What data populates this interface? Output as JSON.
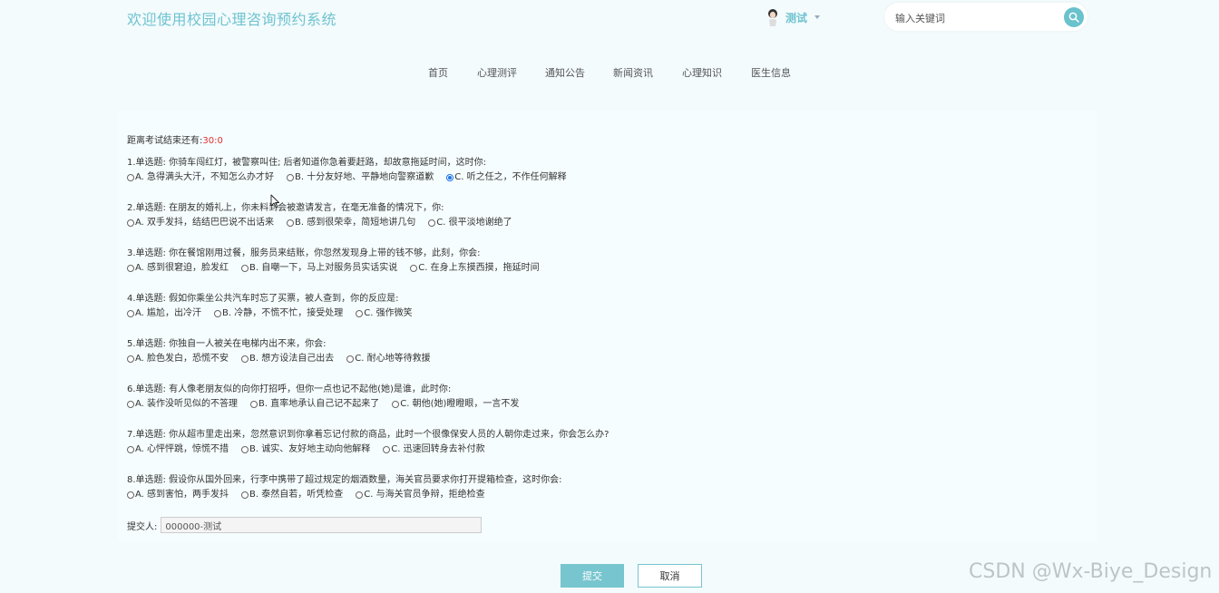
{
  "header": {
    "site_title": "欢迎使用校园心理咨询预约系统",
    "username": "测试",
    "search_placeholder": "输入关键词"
  },
  "nav": {
    "items": [
      "首页",
      "心理测评",
      "通知公告",
      "新闻资讯",
      "心理知识",
      "医生信息"
    ]
  },
  "exam": {
    "timer_label": "距离考试结束还有:",
    "timer_value": "30:0",
    "questions": [
      {
        "title": "1.单选题: 你骑车闯红灯，被警察叫住; 后者知道你急着要赶路，却故意拖延时间，这时你:",
        "options": [
          "A. 急得满头大汗，不知怎么办才好",
          "B. 十分友好地、平静地向警察道歉",
          "C. 听之任之，不作任何解释"
        ],
        "selected": 2
      },
      {
        "title": "2.单选题: 在朋友的婚礼上，你未料到会被邀请发言，在毫无准备的情况下，你:",
        "options": [
          "A. 双手发抖，结结巴巴说不出话来",
          "B. 感到很荣幸，简短地讲几句",
          "C. 很平淡地谢绝了"
        ],
        "selected": -1
      },
      {
        "title": "3.单选题: 你在餐馆刚用过餐，服务员来结账，你忽然发现身上带的钱不够，此刻，你会:",
        "options": [
          "A. 感到很窘迫，脸发红",
          "B. 自嘲一下，马上对服务员实话实说",
          "C. 在身上东摸西摸，拖延时间"
        ],
        "selected": -1
      },
      {
        "title": "4.单选题: 假如你乘坐公共汽车时忘了买票，被人查到，你的反应是:",
        "options": [
          "A. 尴尬，出冷汗",
          "B. 冷静，不慌不忙，接受处理",
          "C. 强作微笑"
        ],
        "selected": -1
      },
      {
        "title": "5.单选题: 你独自一人被关在电梯内出不来，你会:",
        "options": [
          "A. 脸色发白，恐慌不安",
          "B. 想方设法自己出去",
          "C. 耐心地等待救援"
        ],
        "selected": -1
      },
      {
        "title": "6.单选题: 有人像老朋友似的向你打招呼，但你一点也记不起他(她)是谁，此时你:",
        "options": [
          "A. 装作没听见似的不答理",
          "B. 直率地承认自己记不起来了",
          "C. 朝他(她)瞪瞪眼，一言不发"
        ],
        "selected": -1
      },
      {
        "title": "7.单选题: 你从超市里走出来，忽然意识到你拿着忘记付款的商品，此时一个很像保安人员的人朝你走过来，你会怎么办?",
        "options": [
          "A. 心怦怦跳，惊慌不措",
          "B. 诚实、友好地主动向他解释",
          "C. 迅速回转身去补付款"
        ],
        "selected": -1
      },
      {
        "title": "8.单选题: 假设你从国外回来，行李中携带了超过规定的烟酒数量，海关官员要求你打开提箱检查，这时你会:",
        "options": [
          "A. 感到害怕，两手发抖",
          "B. 泰然自若，听凭检查",
          "C. 与海关官员争辩，拒绝检查"
        ],
        "selected": -1
      }
    ],
    "submitter_label": "提交人:",
    "submitter_value": "000000-测试",
    "submit_label": "提交",
    "cancel_label": "取消"
  },
  "watermark": "CSDN @Wx-Biye_Design",
  "colors": {
    "accent": "#6fc3cf",
    "button": "#77c5cf",
    "timer": "#e03030",
    "background": "#f3fbfd"
  }
}
